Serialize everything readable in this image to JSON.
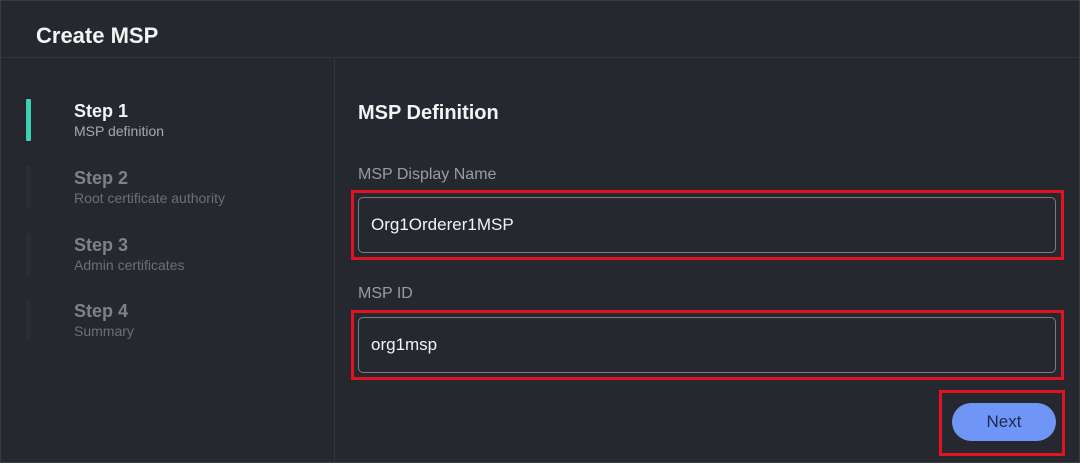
{
  "modal": {
    "title": "Create MSP"
  },
  "steps": [
    {
      "label": "Step 1",
      "description": "MSP definition",
      "active": true
    },
    {
      "label": "Step 2",
      "description": "Root certificate authority",
      "active": false
    },
    {
      "label": "Step 3",
      "description": "Admin certificates",
      "active": false
    },
    {
      "label": "Step 4",
      "description": "Summary",
      "active": false
    }
  ],
  "form": {
    "section_title": "MSP Definition",
    "display_name": {
      "label": "MSP Display Name",
      "value": "Org1Orderer1MSP"
    },
    "msp_id": {
      "label": "MSP ID",
      "value": "org1msp"
    },
    "next_label": "Next"
  },
  "colors": {
    "active_step_indicator": "#3dd0b4",
    "highlight_box": "#e0141e",
    "primary_button": "#6f95f7"
  }
}
